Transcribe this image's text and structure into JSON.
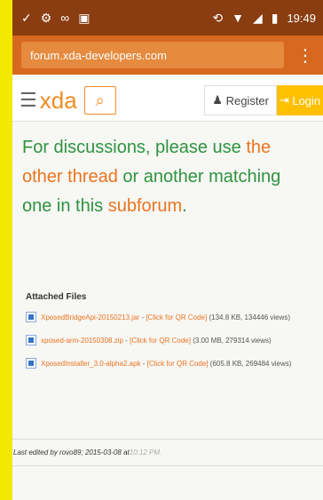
{
  "status_bar": {
    "time": "19:49",
    "icons_left": [
      "check-icon",
      "settings-icon",
      "voicemail-icon",
      "clipboard-icon"
    ],
    "icons_right": [
      "sync-icon",
      "wifi-icon",
      "signal-icon",
      "battery-icon"
    ]
  },
  "browser": {
    "url": "forum.xda-developers.com",
    "menu": "⋮"
  },
  "header": {
    "logo": "xda",
    "register": "Register",
    "login": "Login"
  },
  "message": {
    "prefix": "For discussions, please use ",
    "link1": "the other thread",
    "middle": " or another matching one in this ",
    "link2": "subforum",
    "suffix": "."
  },
  "attachments": {
    "title": "Attached Files",
    "files": [
      {
        "name": "XposedBridgeApi-20150213.jar",
        "qr": "[Click for QR Code]",
        "details": "(134.8 KB, 134446 views)"
      },
      {
        "name": "xposed-arm-20150308.zip",
        "qr": "[Click for QR Code]",
        "details": "(3.00 MB, 279314 views)"
      },
      {
        "name": "XposedInstaller_3.0-alpha2.apk",
        "qr": "[Click for QR Code]",
        "details": "(605.8 KB, 269484 views)"
      }
    ]
  },
  "footer": {
    "edited_prefix": "Last edited by rovo89; 2015-03-08 at ",
    "edited_time": "10:12 PM."
  }
}
